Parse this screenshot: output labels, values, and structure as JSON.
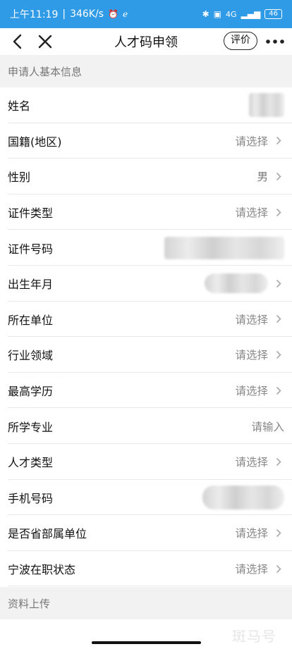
{
  "status_bar": {
    "time": "上午11:19",
    "net_speed": "346K/s",
    "network": "4G",
    "battery": "46",
    "bg_color": "#2f9ae6"
  },
  "nav": {
    "title": "人才码申领",
    "rate_label": "评价",
    "back_icon": "chevron-left-icon",
    "close_icon": "close-icon",
    "more_icon": "more-horizontal-icon"
  },
  "sections": {
    "basic_info": "申请人基本信息",
    "upload": "资料上传"
  },
  "fields": [
    {
      "label": "姓名",
      "value": "",
      "type": "redacted-name"
    },
    {
      "label": "国籍(地区)",
      "value": "请选择",
      "type": "select"
    },
    {
      "label": "性别",
      "value": "男",
      "type": "select"
    },
    {
      "label": "证件类型",
      "value": "请选择",
      "type": "select"
    },
    {
      "label": "证件号码",
      "value": "",
      "type": "redacted-id"
    },
    {
      "label": "出生年月",
      "value": "",
      "type": "redacted-date"
    },
    {
      "label": "所在单位",
      "value": "请选择",
      "type": "select"
    },
    {
      "label": "行业领域",
      "value": "请选择",
      "type": "select"
    },
    {
      "label": "最高学历",
      "value": "请选择",
      "type": "select"
    },
    {
      "label": "所学专业",
      "value": "请输入",
      "type": "input"
    },
    {
      "label": "人才类型",
      "value": "请选择",
      "type": "select"
    },
    {
      "label": "手机号码",
      "value": "",
      "type": "redacted-phone"
    },
    {
      "label": "是否省部属单位",
      "value": "请选择",
      "type": "select"
    },
    {
      "label": "宁波在职状态",
      "value": "请选择",
      "type": "select"
    }
  ],
  "watermark": "斑马号"
}
